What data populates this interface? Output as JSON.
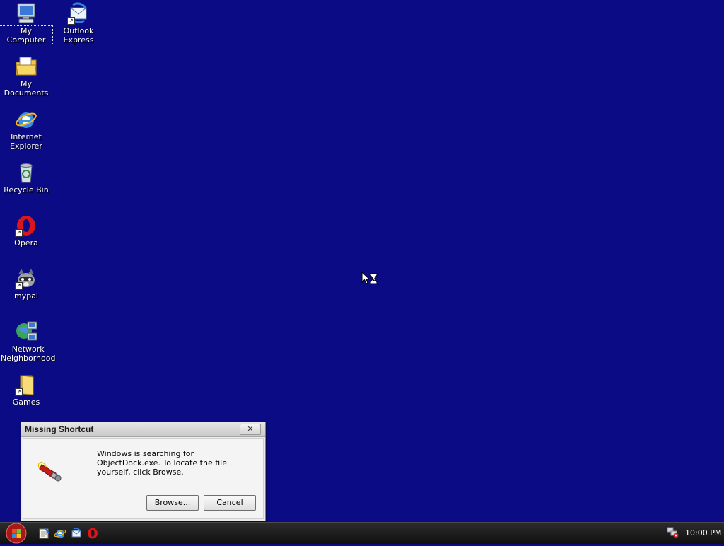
{
  "desktop": {
    "background_color": "#0b0b86",
    "icons": [
      {
        "label": "My Computer",
        "icon": "computer-icon"
      },
      {
        "label": "Outlook Express",
        "icon": "outlook-express-icon"
      },
      {
        "label": "My Documents",
        "icon": "folder-documents-icon"
      },
      {
        "label": "Internet Explorer",
        "icon": "internet-explorer-icon"
      },
      {
        "label": "Recycle Bin",
        "icon": "recycle-bin-icon"
      },
      {
        "label": "Opera",
        "icon": "opera-icon"
      },
      {
        "label": "mypal",
        "icon": "mypal-raccoon-icon"
      },
      {
        "label": "Network Neighborhood",
        "icon": "network-icon"
      },
      {
        "label": "Games",
        "icon": "folder-games-icon"
      }
    ]
  },
  "dialog": {
    "title": "Missing Shortcut",
    "message": "Windows is searching for ObjectDock.exe. To locate the file yourself, click Browse.",
    "close_label": "✕",
    "browse_accel": "B",
    "browse_rest": "rowse...",
    "cancel_label": "Cancel",
    "icon": "flashlight-search-icon"
  },
  "taskbar": {
    "quick_launch": [
      "notepad-icon",
      "internet-explorer-icon",
      "outlook-express-icon",
      "opera-icon"
    ],
    "clock": "10:00 PM"
  }
}
